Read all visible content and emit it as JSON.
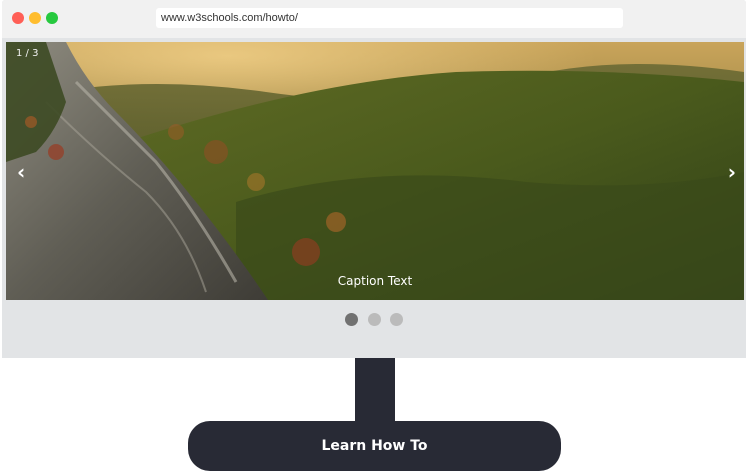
{
  "browser": {
    "url": "www.w3schools.com/howto/"
  },
  "slideshow": {
    "counter": "1 / 3",
    "prev_symbol": "‹",
    "next_symbol": "›",
    "caption": "Caption Text",
    "dots": [
      {
        "active": true
      },
      {
        "active": false
      },
      {
        "active": false
      }
    ]
  },
  "cta": {
    "label": "Learn How To"
  },
  "colors": {
    "frame": "#e2e4e6",
    "titlebar": "#f1f1f1",
    "stand": "#282a35",
    "dot_active": "#717171",
    "dot_inactive": "#bbbbbb"
  }
}
